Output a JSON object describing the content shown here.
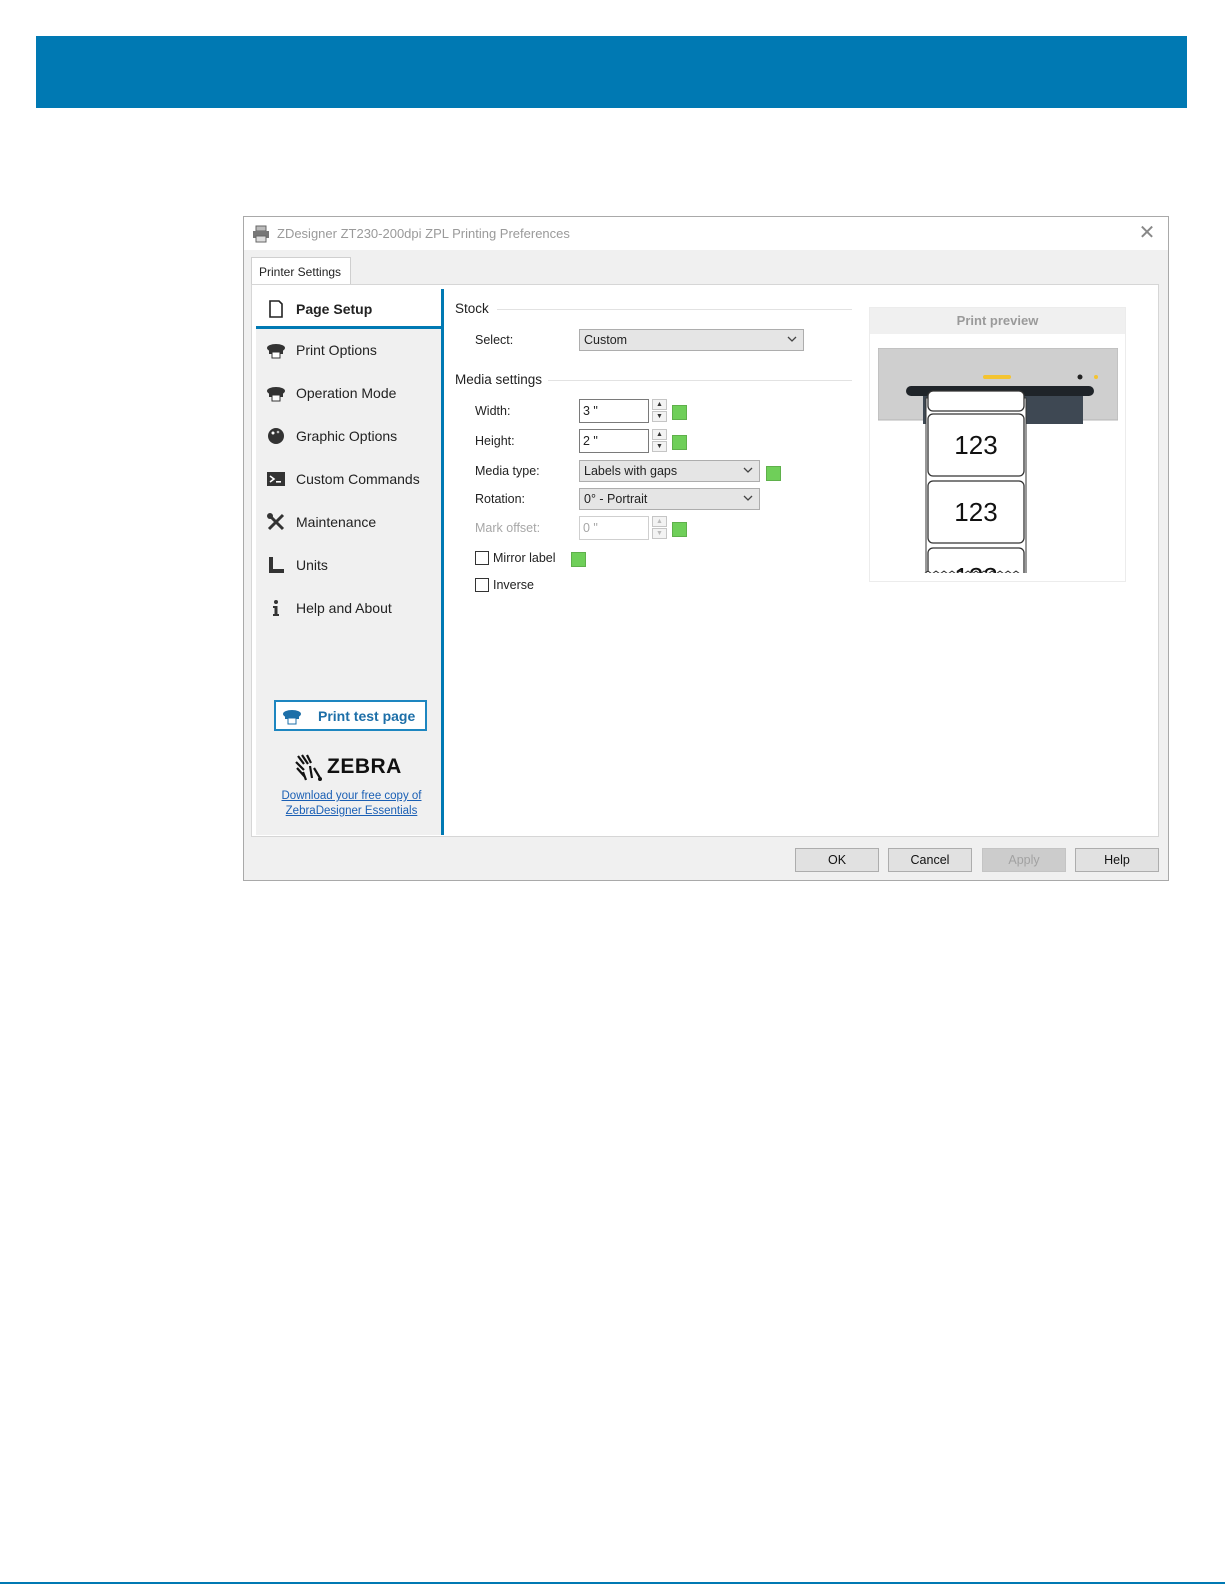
{
  "dialog": {
    "title": "ZDesigner ZT230-200dpi ZPL Printing Preferences",
    "close_glyph": "✕",
    "tab_label": "Printer Settings"
  },
  "sidebar": {
    "items": [
      {
        "label": "Page Setup",
        "icon": "page-icon",
        "active": true
      },
      {
        "label": "Print Options",
        "icon": "printer-icon"
      },
      {
        "label": "Operation Mode",
        "icon": "printer-icon"
      },
      {
        "label": "Graphic Options",
        "icon": "palette-icon"
      },
      {
        "label": "Custom Commands",
        "icon": "terminal-icon"
      },
      {
        "label": "Maintenance",
        "icon": "wrench-screwdriver-icon"
      },
      {
        "label": "Units",
        "icon": "ruler-icon"
      },
      {
        "label": "Help and About",
        "icon": "info-icon"
      }
    ],
    "print_test_label": "Print test page",
    "logo_text": "ZEBRA",
    "download_link": "Download your free copy of ZebraDesigner Essentials"
  },
  "stock": {
    "heading": "Stock",
    "select_label": "Select:",
    "select_value": "Custom"
  },
  "media": {
    "heading": "Media settings",
    "width_label": "Width:",
    "width_value": "3 \"",
    "height_label": "Height:",
    "height_value": "2 \"",
    "media_type_label": "Media type:",
    "media_type_value": "Labels with gaps",
    "rotation_label": "Rotation:",
    "rotation_value": "0° - Portrait",
    "mark_offset_label": "Mark offset:",
    "mark_offset_value": "0 \"",
    "mirror_label": "Mirror label",
    "mirror_checked": false,
    "inverse_label": "Inverse",
    "inverse_checked": false
  },
  "preview": {
    "heading": "Print preview",
    "label_text": "123"
  },
  "buttons": {
    "ok": "OK",
    "cancel": "Cancel",
    "apply": "Apply",
    "help": "Help"
  },
  "colors": {
    "banner": "#0079b3",
    "accent": "#0079b3",
    "green_indicator": "#6fcf59"
  }
}
